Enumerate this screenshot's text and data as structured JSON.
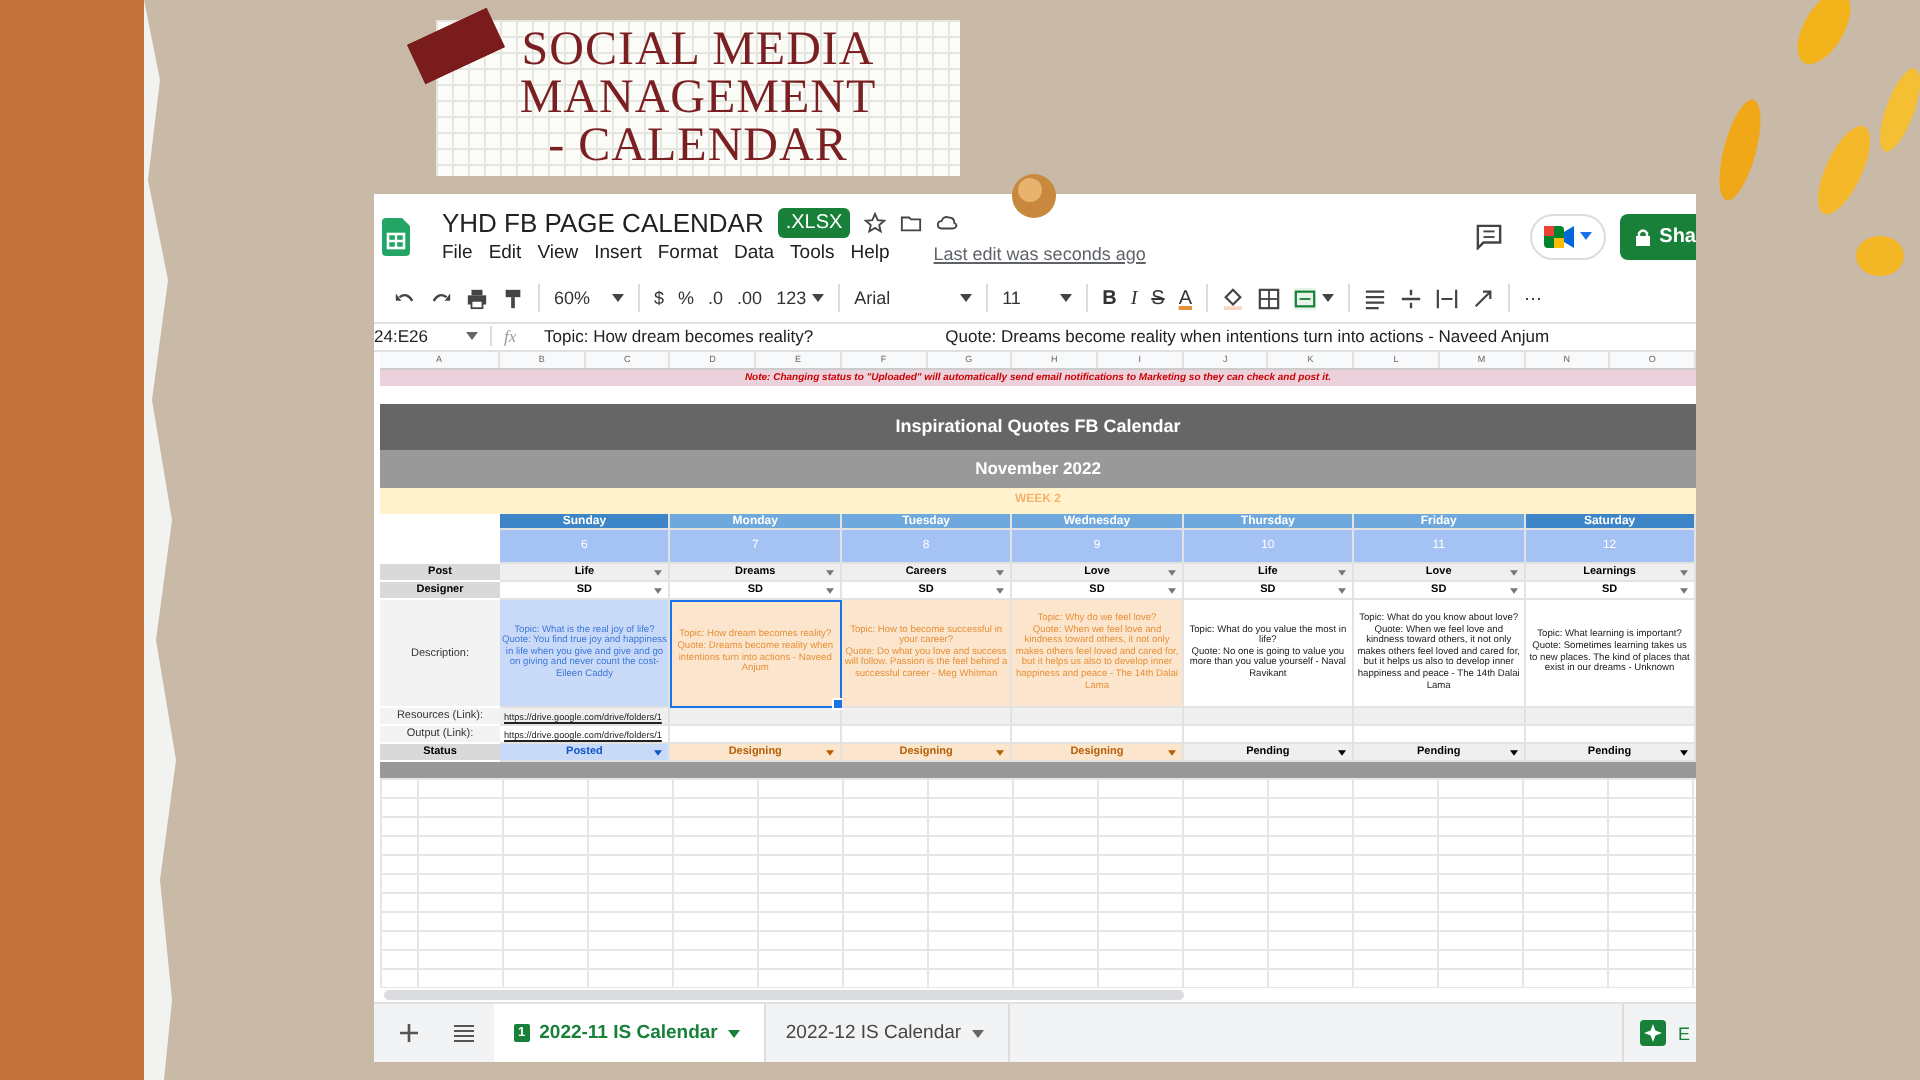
{
  "slide_title": [
    "SOCIAL MEDIA",
    "MANAGEMENT",
    "- CALENDAR"
  ],
  "doc": {
    "title": "YHD FB PAGE CALENDAR",
    "format_badge": ".XLSX",
    "menu": [
      "File",
      "Edit",
      "View",
      "Insert",
      "Format",
      "Data",
      "Tools",
      "Help"
    ],
    "last_edit": "Last edit was seconds ago",
    "share": "Sha"
  },
  "toolbar": {
    "zoom": "60%",
    "currency": "$",
    "percent": "%",
    "decrease_decimal": ".0",
    "increase_decimal": ".00",
    "number_format": "123",
    "font": "Arial",
    "font_size": "11",
    "bold": "B",
    "italic": "I",
    "strikethrough": "S",
    "text_color": "A",
    "more": "⋯"
  },
  "formula_bar": {
    "name_box": "24:E26",
    "fx": "fx",
    "content": [
      "Topic: How dream becomes reality?",
      "Quote: Dreams become reality when intentions turn into actions - Naveed Anjum"
    ]
  },
  "columns": [
    "A",
    "B",
    "C",
    "D",
    "E",
    "F",
    "G",
    "H",
    "I",
    "J",
    "K",
    "L",
    "M",
    "N",
    "O"
  ],
  "sheet": {
    "note": "Note: Changing status to \"Uploaded\" will automatically send email notifications to Marketing so they can check and post it.",
    "title": "Inspirational Quotes FB Calendar",
    "month": "November 2022",
    "week": "WEEK 2",
    "row_labels": {
      "post": "Post",
      "designer": "Designer",
      "description": "Description:",
      "resources": "Resources (Link):",
      "output": "Output (Link):",
      "status": "Status"
    },
    "days": [
      {
        "name": "Sunday",
        "date": "6",
        "highlighted": true,
        "post": "Life",
        "designer": "SD",
        "topic": "Topic: What is the real joy of life?",
        "quote": "Quote: You find true joy and happiness in life when you give and give and go on giving and never count the cost- Eileen Caddy",
        "resources": "https://drive.google.com/drive/folders/1",
        "output": "https://drive.google.com/drive/folders/1",
        "status": {
          "label": "Posted",
          "kind": "posted"
        },
        "selected": false
      },
      {
        "name": "Monday",
        "date": "7",
        "highlighted": false,
        "post": "Dreams",
        "designer": "SD",
        "topic": "Topic: How dream becomes reality?",
        "quote": "Quote: Dreams become reality when intentions turn into actions - Naveed Anjum",
        "status": {
          "label": "Designing",
          "kind": "designing"
        },
        "selected": true
      },
      {
        "name": "Tuesday",
        "date": "8",
        "highlighted": false,
        "post": "Careers",
        "designer": "SD",
        "topic": "Topic: How to become successful in your career?",
        "quote": "Quote: Do what you love and success will follow. Passion is the feel behind a successful career - Meg Whitman",
        "status": {
          "label": "Designing",
          "kind": "designing"
        },
        "selected": false
      },
      {
        "name": "Wednesday",
        "date": "9",
        "highlighted": false,
        "post": "Love",
        "designer": "SD",
        "topic": "Topic: Why do we feel love?",
        "quote": "Quote: When we feel love and kindness toward others, it not only makes others feel loved and cared for, but it helps us also to develop inner happiness and peace - The 14th Dalai Lama",
        "status": {
          "label": "Designing",
          "kind": "designing"
        },
        "selected": false
      },
      {
        "name": "Thursday",
        "date": "10",
        "highlighted": false,
        "post": "Life",
        "designer": "SD",
        "topic": "Topic: What do you value the most in life?",
        "quote": "Quote: No one is going to value you more than you value yourself - Naval Ravikant",
        "status": {
          "label": "Pending",
          "kind": "pending"
        },
        "selected": false
      },
      {
        "name": "Friday",
        "date": "11",
        "highlighted": false,
        "post": "Love",
        "designer": "SD",
        "topic": "Topic: What do you know about love?",
        "quote": "Quote: When we feel love and kindness toward others, it not only makes others feel loved and cared for, but it helps us also to develop inner happiness and peace - The 14th Dalai Lama",
        "status": {
          "label": "Pending",
          "kind": "pending"
        },
        "selected": false
      },
      {
        "name": "Saturday",
        "date": "12",
        "highlighted": true,
        "post": "Learnings",
        "designer": "SD",
        "topic": "Topic: What learning is important?",
        "quote": "Quote: Sometimes learning takes us to new places. The kind of places that exist in our dreams - Unknown",
        "status": {
          "label": "Pending",
          "kind": "pending"
        },
        "selected": false
      }
    ]
  },
  "sheet_tabs": [
    {
      "label": "2022-11 IS Calendar",
      "badge": "1",
      "selected": true
    },
    {
      "label": "2022-12 IS Calendar",
      "selected": false
    }
  ],
  "explore": "E"
}
